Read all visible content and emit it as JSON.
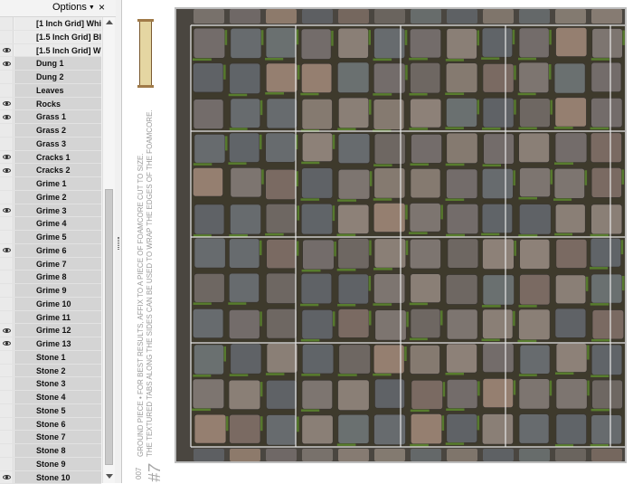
{
  "panel": {
    "options_label": "Options",
    "close_label": "×",
    "layers": [
      {
        "name": "[1 Inch Grid] Whit",
        "visible": false
      },
      {
        "name": "[1.5 Inch Grid] Bla",
        "visible": false
      },
      {
        "name": "[1.5 Inch Grid] Wh",
        "visible": true
      },
      {
        "name": "Dung 1",
        "visible": true
      },
      {
        "name": "Dung 2",
        "visible": false
      },
      {
        "name": "Leaves",
        "visible": false
      },
      {
        "name": "Rocks",
        "visible": true
      },
      {
        "name": "Grass 1",
        "visible": true
      },
      {
        "name": "Grass 2",
        "visible": false
      },
      {
        "name": "Grass 3",
        "visible": false
      },
      {
        "name": "Cracks 1",
        "visible": true
      },
      {
        "name": "Cracks 2",
        "visible": true
      },
      {
        "name": "Grime 1",
        "visible": false
      },
      {
        "name": "Grime 2",
        "visible": false
      },
      {
        "name": "Grime 3",
        "visible": true
      },
      {
        "name": "Grime 4",
        "visible": false
      },
      {
        "name": "Grime 5",
        "visible": false
      },
      {
        "name": "Grime 6",
        "visible": true
      },
      {
        "name": "Grime 7",
        "visible": false
      },
      {
        "name": "Grime 8",
        "visible": false
      },
      {
        "name": "Grime 9",
        "visible": false
      },
      {
        "name": "Grime 10",
        "visible": false
      },
      {
        "name": "Grime 11",
        "visible": false
      },
      {
        "name": "Grime 12",
        "visible": true
      },
      {
        "name": "Grime 13",
        "visible": true
      },
      {
        "name": "Stone 1",
        "visible": false
      },
      {
        "name": "Stone 2",
        "visible": false
      },
      {
        "name": "Stone 3",
        "visible": false
      },
      {
        "name": "Stone 4",
        "visible": false
      },
      {
        "name": "Stone 5",
        "visible": false
      },
      {
        "name": "Stone 6",
        "visible": false
      },
      {
        "name": "Stone 7",
        "visible": false
      },
      {
        "name": "Stone 8",
        "visible": false
      },
      {
        "name": "Stone 9",
        "visible": false
      },
      {
        "name": "Stone 10",
        "visible": true
      }
    ]
  },
  "canvas": {
    "side_text_line1": "GROUND PIECE • FOR BEST RESULTS, AFFIX TO A PIECE OF FOAMCORE CUT TO SIZE.",
    "side_text_line2": "THE TEXTURED TABS ALONG THE SIDES CAN BE USED TO WRAP THE EDGES OF THE FOAMCORE.",
    "code_text": "007",
    "number_text": "#7"
  },
  "colors": {
    "stone_palette": [
      "#7d7570",
      "#6e6762",
      "#8a7f76",
      "#5f6266",
      "#857a70",
      "#736c6a",
      "#6a7070",
      "#8d8178",
      "#7a6a62",
      "#676b6e",
      "#957f70",
      "#606468"
    ],
    "grass": "#5d8a2e",
    "grout": "#3e3a2c",
    "grid_line": "#e8e8e8"
  }
}
